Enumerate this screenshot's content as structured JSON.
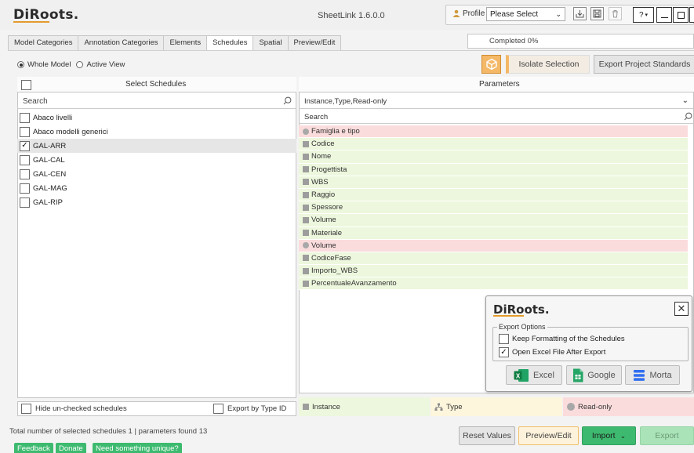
{
  "app": {
    "logo": "DiRoots.",
    "logo_main": "DiRo",
    "logo_tail": "ots.",
    "title": "SheetLink 1.6.0.0"
  },
  "profile": {
    "label": "Profile",
    "selected": "Please Select"
  },
  "window_controls": {
    "help": "?"
  },
  "tabs": [
    {
      "label": "Model Categories",
      "active": false
    },
    {
      "label": "Annotation Categories",
      "active": false
    },
    {
      "label": "Elements",
      "active": false
    },
    {
      "label": "Schedules",
      "active": true
    },
    {
      "label": "Spatial",
      "active": false
    },
    {
      "label": "Preview/Edit",
      "active": false
    }
  ],
  "progress_text": "Completed  0%",
  "scope": {
    "whole_model": "Whole Model",
    "active_view": "Active View",
    "selected": "whole_model"
  },
  "toolbar": {
    "isolate": "Isolate Selection",
    "export_standards": "Export Project Standards"
  },
  "left": {
    "title": "Select Schedules",
    "search_placeholder": "Search",
    "items": [
      {
        "label": "Abaco livelli",
        "checked": false
      },
      {
        "label": "Abaco modelli generici",
        "checked": false
      },
      {
        "label": "GAL-ARR",
        "checked": true
      },
      {
        "label": "GAL-CAL",
        "checked": false
      },
      {
        "label": "GAL-CEN",
        "checked": false
      },
      {
        "label": "GAL-MAG",
        "checked": false
      },
      {
        "label": "GAL-RIP",
        "checked": false
      }
    ],
    "hide_unchecked": "Hide un-checked schedules",
    "export_by_type": "Export by Type ID"
  },
  "right": {
    "title": "Parameters",
    "type_filter": "Instance,Type,Read-only",
    "search_placeholder": "Search",
    "params": [
      {
        "label": "Famiglia e tipo",
        "kind": "readonly"
      },
      {
        "label": "Codice",
        "kind": "instance"
      },
      {
        "label": "Nome",
        "kind": "instance"
      },
      {
        "label": "Progettista",
        "kind": "instance"
      },
      {
        "label": "WBS",
        "kind": "instance"
      },
      {
        "label": "Raggio",
        "kind": "instance"
      },
      {
        "label": "Spessore",
        "kind": "instance"
      },
      {
        "label": "Volume",
        "kind": "instance"
      },
      {
        "label": "Materiale",
        "kind": "instance"
      },
      {
        "label": "Volume",
        "kind": "readonly"
      },
      {
        "label": "CodiceFase",
        "kind": "instance"
      },
      {
        "label": "Importo_WBS",
        "kind": "instance"
      },
      {
        "label": "PercentualeAvanzamento",
        "kind": "instance"
      }
    ],
    "legend": {
      "instance": "Instance",
      "type": "Type",
      "readonly": "Read-only"
    }
  },
  "popup": {
    "logo": "DiRoots.",
    "logo_main": "DiRo",
    "logo_tail": "ots.",
    "options_title": "Export Options",
    "keep_formatting": "Keep Formatting of the Schedules",
    "keep_formatting_checked": false,
    "open_excel": "Open Excel File After Export",
    "open_excel_checked": true,
    "excel": "Excel",
    "google": "Google",
    "morta": "Morta"
  },
  "status": "Total number of selected schedules 1 | parameters found 13",
  "bottom": {
    "reset": "Reset Values",
    "preview": "Preview/Edit",
    "import": "Import",
    "export": "Export"
  },
  "links": {
    "feedback": "Feedback",
    "donate": "Donate",
    "need": "Need something unique?"
  },
  "colors": {
    "accent_orange": "#f4b867",
    "instance_bg": "#edf7dd",
    "type_bg": "#fdf5dc",
    "readonly_bg": "#fbdcdc",
    "green": "#3dba6f"
  }
}
